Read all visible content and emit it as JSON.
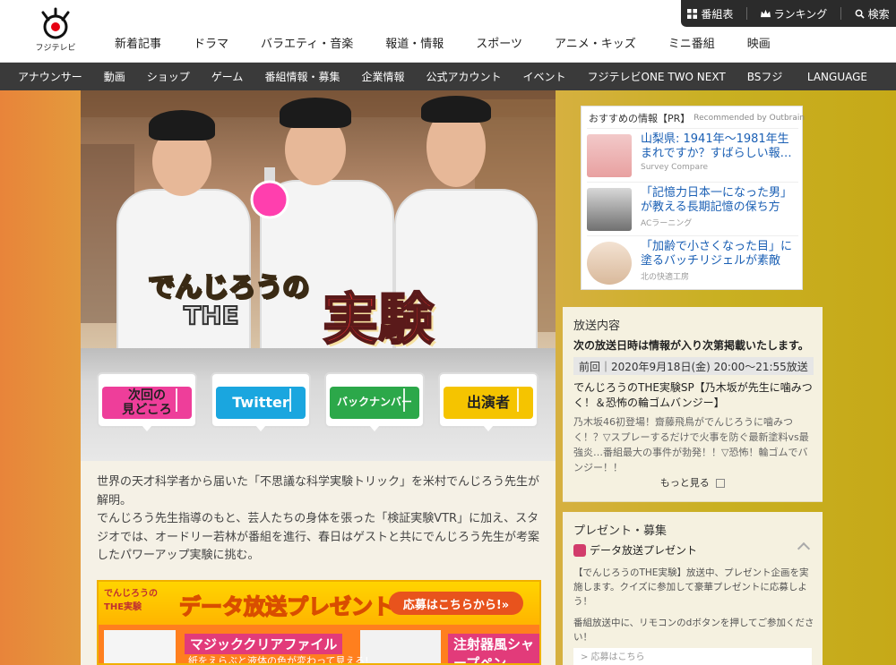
{
  "header": {
    "logo_text": "フジテレビ",
    "nav": [
      "新着記事",
      "ドラマ",
      "バラエティ・音楽",
      "報道・情報",
      "スポーツ",
      "アニメ・キッズ",
      "ミニ番組",
      "映画"
    ],
    "utility": {
      "program_guide": "番組表",
      "ranking": "ランキング",
      "search": "検索"
    }
  },
  "sub_nav": {
    "items": [
      "アナウンサー",
      "動画",
      "ショップ",
      "ゲーム",
      "番組情報・募集",
      "企業情報",
      "公式アカウント",
      "イベント",
      "フジテレビONE TWO NEXT",
      "BSフジ"
    ],
    "language": "LANGUAGE"
  },
  "hero": {
    "title_small": "でんじろうの",
    "title_the": "THE",
    "title_big": "実験"
  },
  "buttons": [
    {
      "label": "次回の\n見どころ",
      "color": "#ee3e9a"
    },
    {
      "label": "Twitter",
      "color": "#1aa6df"
    },
    {
      "label": "バックナンバー",
      "color": "#2ca84a"
    },
    {
      "label": "出演者",
      "color": "#f5c400"
    }
  ],
  "description": {
    "para1": "世界の天才科学者から届いた「不思議な科学実験トリック」を米村でんじろう先生が解明。",
    "para2": "でんじろう先生指導のもと、芸人たちの身体を張った「検証実験VTR」に加え、スタジオでは、オードリー若林が番組を進行、春日はゲストと共にでんじろう先生が考案したパワーアップ実験に挑む。"
  },
  "banner": {
    "logo": "でんじろうのTHE実験",
    "title": "データ放送プレゼント",
    "apply": "応募はこちらから!»",
    "item1": "マジッククリアファイル",
    "item2": "注射器風シャープペン",
    "note": "紙をえらぶと液体の色が変わって見える!"
  },
  "ad": {
    "heading": "おすすめの情報【PR】",
    "provider": "Recommended by Outbrain",
    "items": [
      {
        "title": "山梨県: 1941年〜1981年生まれですか？すばらしい報…",
        "source": "Survey Compare"
      },
      {
        "title": "「記憶力日本一になった男」が教える長期記憶の保ち方",
        "source": "ACラーニング"
      },
      {
        "title": "「加齢で小さくなった目」に塗るバッチリジェルが素敵",
        "source": "北の快適工房"
      }
    ]
  },
  "broadcast": {
    "heading": "放送内容",
    "notice": "次の放送日時は情報が入り次第掲載いたします。",
    "date": "前回｜2020年9月18日(金) 20:00〜21:55放送",
    "episode_title": "でんじろうのTHE実験SP【乃木坂が先生に噛みつく！＆恐怖の輪ゴムバンジー】",
    "episode_desc": "乃木坂46初登場！齋藤飛鳥がでんじろうに噛みつく！？▽スプレーするだけで火事を防ぐ最新塗料vs最強炎…番組最大の事件が勃発！！▽恐怖！輪ゴムでバンジー！！",
    "more": "もっと見る"
  },
  "present": {
    "heading": "プレゼント・募集",
    "sub": "データ放送プレゼント",
    "text1": "【でんじろうのTHE実験】放送中、プレゼント企画を実施します。クイズに参加して豪華プレゼントに応募しよう！",
    "text2": "番組放送中に、リモコンのdボタンを押してご参加ください！",
    "link": "> 応募はこちら"
  }
}
